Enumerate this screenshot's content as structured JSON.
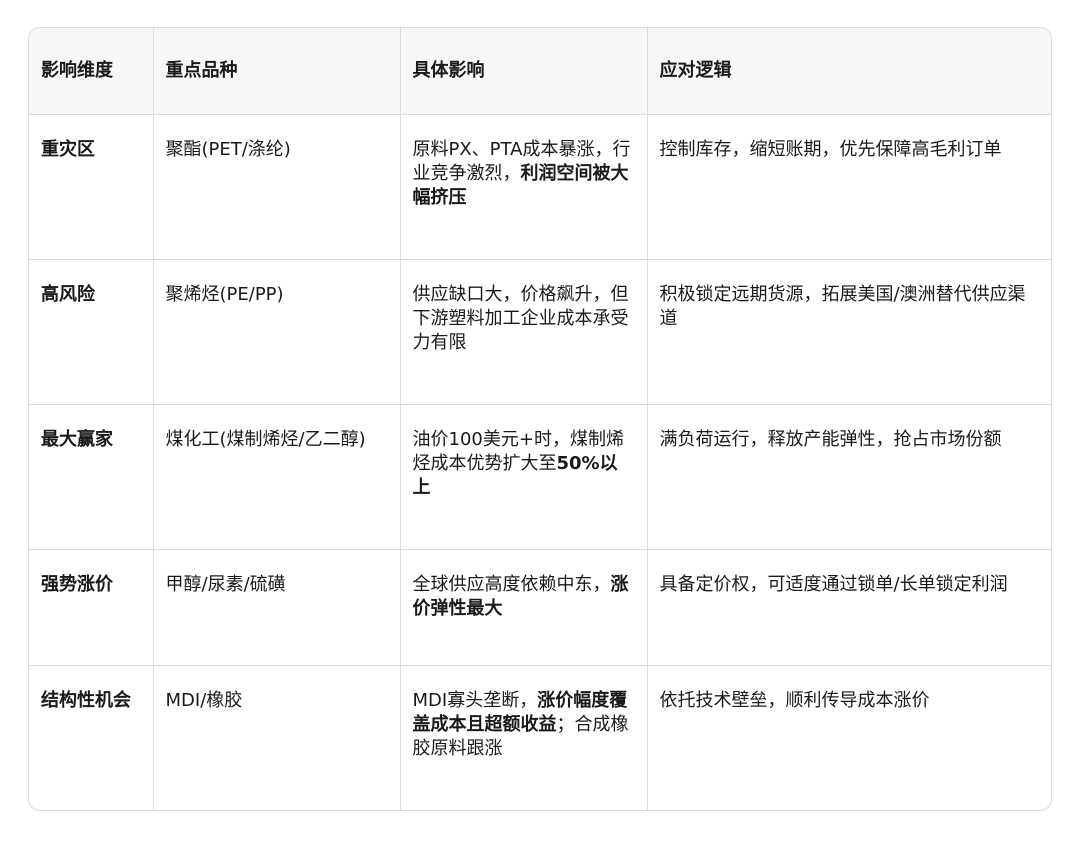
{
  "table": {
    "headers": [
      "影响维度",
      "重点品种",
      "具体影响",
      "应对逻辑"
    ],
    "rows": [
      {
        "dimension": "重灾区",
        "variety": "聚酯(PET/涤纶)",
        "impact": [
          {
            "text": "原料PX、PTA成本暴涨，行业竞争激烈，",
            "bold": false
          },
          {
            "text": "利润空间被大幅挤压",
            "bold": true
          }
        ],
        "strategy": "控制库存，缩短账期，优先保障高毛利订单"
      },
      {
        "dimension": "高风险",
        "variety": "聚烯烃(PE/PP)",
        "impact": [
          {
            "text": "供应缺口大，价格飙升，但下游塑料加工企业成本承受力有限",
            "bold": false
          }
        ],
        "strategy": "积极锁定远期货源，拓展美国/澳洲替代供应渠道"
      },
      {
        "dimension": "最大赢家",
        "variety": "煤化工(煤制烯烃/乙二醇)",
        "impact": [
          {
            "text": "油价100美元+时，煤制烯烃成本优势扩大至",
            "bold": false
          },
          {
            "text": "50%以上",
            "bold": true
          }
        ],
        "strategy": "满负荷运行，释放产能弹性，抢占市场份额"
      },
      {
        "dimension": "强势涨价",
        "variety": "甲醇/尿素/硫磺",
        "impact": [
          {
            "text": "全球供应高度依赖中东，",
            "bold": false
          },
          {
            "text": "涨价弹性最大",
            "bold": true
          }
        ],
        "strategy": "具备定价权，可适度通过锁单/长单锁定利润"
      },
      {
        "dimension": "结构性机会",
        "variety": "MDI/橡胶",
        "impact": [
          {
            "text": "MDI寡头垄断，",
            "bold": false
          },
          {
            "text": "涨价幅度覆盖成本且超额收益",
            "bold": true
          },
          {
            "text": "；合成橡胶原料跟涨",
            "bold": false
          }
        ],
        "strategy": "依托技术壁垒，顺利传导成本涨价"
      }
    ]
  }
}
